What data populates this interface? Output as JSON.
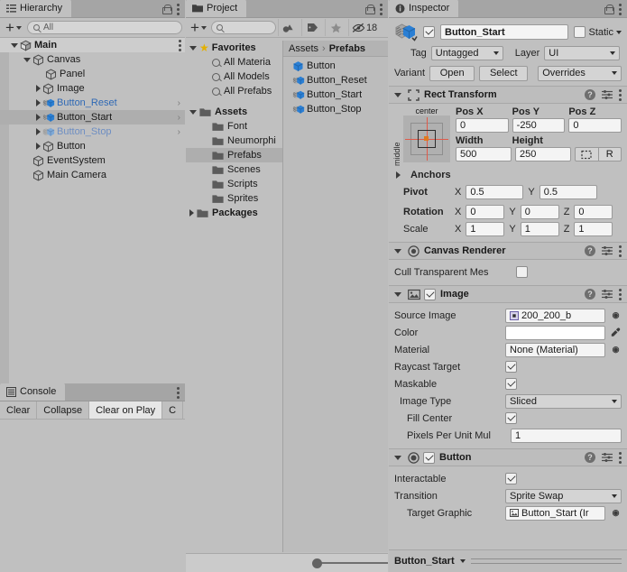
{
  "hierarchy": {
    "tab_label": "Hierarchy",
    "tab_icon": "hierarchy-icon",
    "add_label": "+",
    "search_placeholder": "All",
    "rows": [
      {
        "label": "Main",
        "indent": 0,
        "tri": "down",
        "icon": "scene-icon",
        "style": "bold",
        "row": "main",
        "chevron": false
      },
      {
        "label": "Canvas",
        "indent": 1,
        "tri": "down",
        "icon": "gameobject-icon",
        "style": "",
        "row": "",
        "chevron": false
      },
      {
        "label": "Panel",
        "indent": 2,
        "tri": "none",
        "icon": "gameobject-icon",
        "style": "",
        "row": "",
        "chevron": false
      },
      {
        "label": "Image",
        "indent": 2,
        "tri": "right",
        "icon": "gameobject-icon",
        "style": "",
        "row": "",
        "chevron": false
      },
      {
        "label": "Button_Reset",
        "indent": 2,
        "tri": "right",
        "icon": "prefab-variant-icon",
        "style": "blue",
        "row": "",
        "chevron": true
      },
      {
        "label": "Button_Start",
        "indent": 2,
        "tri": "right",
        "icon": "prefab-variant-icon",
        "style": "",
        "row": "sel",
        "chevron": true
      },
      {
        "label": "Button_Stop",
        "indent": 2,
        "tri": "right",
        "icon": "prefab-variant-icon",
        "style": "bluefade",
        "row": "",
        "chevron": true
      },
      {
        "label": "Button",
        "indent": 2,
        "tri": "right",
        "icon": "gameobject-icon",
        "style": "",
        "row": "",
        "chevron": false
      },
      {
        "label": "EventSystem",
        "indent": 1,
        "tri": "none",
        "icon": "gameobject-icon",
        "style": "",
        "row": "",
        "chevron": false
      },
      {
        "label": "Main Camera",
        "indent": 1,
        "tri": "none",
        "icon": "gameobject-icon",
        "style": "",
        "row": "",
        "chevron": false
      }
    ]
  },
  "console": {
    "tab_label": "Console",
    "tab_icon": "console-icon",
    "buttons": [
      {
        "label": "Clear",
        "active": false
      },
      {
        "label": "Collapse",
        "active": false
      },
      {
        "label": "Clear on Play",
        "active": true
      },
      {
        "label": "C",
        "active": false
      }
    ]
  },
  "project": {
    "tab_label": "Project",
    "tab_icon": "folder-icon",
    "add_label": "+",
    "search_placeholder": "",
    "toolbar_icons": [
      "asset-type-icon",
      "label-icon",
      "favorite-star-icon"
    ],
    "hidden_count": "18",
    "hidden_icon": "eye-off-icon",
    "breadcrumb": [
      "Assets",
      "Prefabs"
    ],
    "tree": [
      {
        "label": "Favorites",
        "indent": 0,
        "tri": "down",
        "icon": "star-icon",
        "style": "bold",
        "sel": false
      },
      {
        "label": "All Materia",
        "indent": 1,
        "tri": "none",
        "icon": "search-icon",
        "style": "",
        "sel": false
      },
      {
        "label": "All Models",
        "indent": 1,
        "tri": "none",
        "icon": "search-icon",
        "style": "",
        "sel": false
      },
      {
        "label": "All Prefabs",
        "indent": 1,
        "tri": "none",
        "icon": "search-icon",
        "style": "",
        "sel": false
      },
      {
        "label": "",
        "indent": 0,
        "tri": "none",
        "icon": "spacer",
        "style": "",
        "sel": false
      },
      {
        "label": "Assets",
        "indent": 0,
        "tri": "down",
        "icon": "folder-icon",
        "style": "bold",
        "sel": false
      },
      {
        "label": "Font",
        "indent": 1,
        "tri": "none",
        "icon": "folder-icon",
        "style": "",
        "sel": false
      },
      {
        "label": "Neumorphi",
        "indent": 1,
        "tri": "none",
        "icon": "folder-icon",
        "style": "",
        "sel": false
      },
      {
        "label": "Prefabs",
        "indent": 1,
        "tri": "none",
        "icon": "folder-icon",
        "style": "",
        "sel": true
      },
      {
        "label": "Scenes",
        "indent": 1,
        "tri": "none",
        "icon": "folder-icon",
        "style": "",
        "sel": false
      },
      {
        "label": "Scripts",
        "indent": 1,
        "tri": "none",
        "icon": "folder-icon",
        "style": "",
        "sel": false
      },
      {
        "label": "Sprites",
        "indent": 1,
        "tri": "none",
        "icon": "folder-icon",
        "style": "",
        "sel": false
      },
      {
        "label": "Packages",
        "indent": 0,
        "tri": "right",
        "icon": "folder-icon",
        "style": "bold",
        "sel": false
      }
    ],
    "assets": [
      {
        "label": "Button",
        "icon": "prefab-icon"
      },
      {
        "label": "Button_Reset",
        "icon": "prefab-variant-icon"
      },
      {
        "label": "Button_Start",
        "icon": "prefab-variant-icon"
      },
      {
        "label": "Button_Stop",
        "icon": "prefab-variant-icon"
      }
    ],
    "zoom_slider_value": 12
  },
  "inspector": {
    "tab_label": "Inspector",
    "tab_icon": "info-icon",
    "object_icon": "prefab-variant-icon",
    "enabled": true,
    "object_name": "Button_Start",
    "static_label": "Static",
    "static_checked": false,
    "tag_label": "Tag",
    "tag_value": "Untagged",
    "layer_label": "Layer",
    "layer_value": "UI",
    "variant_label": "Variant",
    "open_label": "Open",
    "select_label": "Select",
    "overrides_label": "Overrides",
    "rect_transform": {
      "title": "Rect Transform",
      "icon": "rect-transform-icon",
      "anchor_preset_top": "center",
      "anchor_preset_left": "middle",
      "pos_x_label": "Pos X",
      "pos_y_label": "Pos Y",
      "pos_z_label": "Pos Z",
      "pos_x": "0",
      "pos_y": "-250",
      "pos_z": "0",
      "width_label": "Width",
      "height_label": "Height",
      "width": "500",
      "height": "250",
      "blueprint_icon": "blueprint-mode-icon",
      "raw_edit_label": "R",
      "anchors_label": "Anchors",
      "pivot_label": "Pivot",
      "pivot_x": "0.5",
      "pivot_y": "0.5",
      "rotation_label": "Rotation",
      "rotation_x": "0",
      "rotation_y": "0",
      "rotation_z": "0",
      "scale_label": "Scale",
      "scale_x": "1",
      "scale_y": "1",
      "scale_z": "1",
      "axis_x": "X",
      "axis_y": "Y",
      "axis_z": "Z"
    },
    "canvas_renderer": {
      "title": "Canvas Renderer",
      "icon": "canvas-renderer-icon",
      "cull_label": "Cull Transparent Mes",
      "cull_checked": false
    },
    "image": {
      "title": "Image",
      "icon": "image-icon",
      "enabled": true,
      "source_image_label": "Source Image",
      "source_image_value": "200_200_b",
      "color_label": "Color",
      "color_value": "#FFFFFF",
      "material_label": "Material",
      "material_value": "None (Material)",
      "raycast_label": "Raycast Target",
      "raycast_checked": true,
      "maskable_label": "Maskable",
      "maskable_checked": true,
      "image_type_label": "Image Type",
      "image_type_value": "Sliced",
      "fill_center_label": "Fill Center",
      "fill_center_checked": true,
      "pixels_label": "Pixels Per Unit Mul",
      "pixels_value": "1"
    },
    "button": {
      "title": "Button",
      "icon": "button-icon",
      "enabled": true,
      "interactable_label": "Interactable",
      "interactable_checked": true,
      "transition_label": "Transition",
      "transition_value": "Sprite Swap",
      "target_graphic_label": "Target Graphic",
      "target_graphic_value": "Button_Start (Ir"
    },
    "footer_name": "Button_Start"
  },
  "colors": {
    "panel_bg": "#c0c0c0",
    "tabbar_bg": "#a5a5a5",
    "selection": "#aeaeae",
    "prefab_blue": "#2f69b5",
    "prefab_blue_faded": "#6e8ec2",
    "field_bg": "#f4f4f4",
    "dropdown_bg": "#d4d4d4",
    "anchor_red": "#e05a4a",
    "pivot_orange": "#e07a20",
    "star_yellow": "#e3b000"
  }
}
